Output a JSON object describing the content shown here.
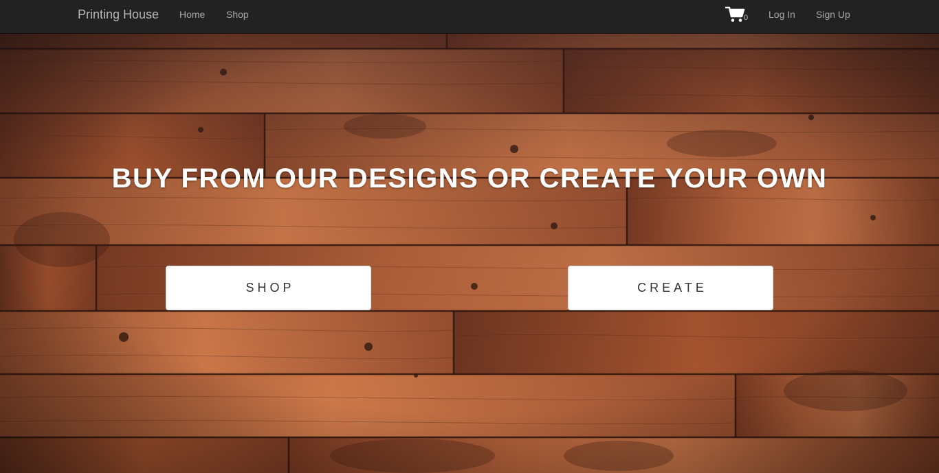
{
  "navbar": {
    "brand": "Printing House",
    "links": {
      "home": "Home",
      "shop": "Shop",
      "login": "Log In",
      "signup": "Sign Up"
    },
    "cart": {
      "icon": "shopping-cart-icon",
      "count": "0"
    }
  },
  "hero": {
    "headline": "BUY FROM OUR DESIGNS OR CREATE YOUR OWN",
    "buttons": {
      "shop": "SHOP",
      "create": "CREATE"
    }
  },
  "colors": {
    "navbar_bg": "#222222",
    "nav_text": "#a8a8a8",
    "button_bg": "#ffffff",
    "button_text": "#333333"
  }
}
